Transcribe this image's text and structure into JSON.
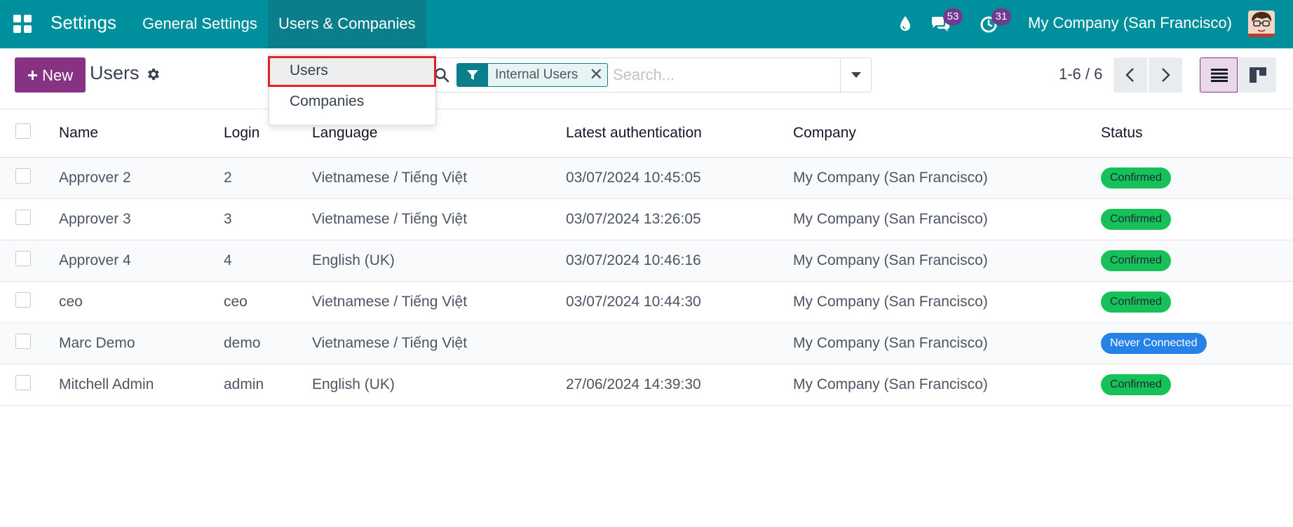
{
  "navbar": {
    "app_name": "Settings",
    "menus": [
      "General Settings",
      "Users & Companies"
    ],
    "messages_count": "53",
    "activities_count": "31",
    "company": "My Company (San Francisco)"
  },
  "dropdown": {
    "items": [
      "Users",
      "Companies"
    ],
    "highlighted": "Users",
    "highlight_color": "#e02424"
  },
  "control_panel": {
    "new_label": "New",
    "title": "Users",
    "facet": "Internal Users",
    "search_placeholder": "Search...",
    "pager": "1-6 / 6"
  },
  "table": {
    "headers": [
      "Name",
      "Login",
      "Language",
      "Latest authentication",
      "Company",
      "Status"
    ],
    "rows": [
      {
        "name": "Approver 2",
        "login": "2",
        "language": "Vietnamese / Tiếng Việt",
        "latest_auth": "03/07/2024 10:45:05",
        "company": "My Company (San Francisco)",
        "status": "Confirmed"
      },
      {
        "name": "Approver 3",
        "login": "3",
        "language": "Vietnamese / Tiếng Việt",
        "latest_auth": "03/07/2024 13:26:05",
        "company": "My Company (San Francisco)",
        "status": "Confirmed"
      },
      {
        "name": "Approver 4",
        "login": "4",
        "language": "English (UK)",
        "latest_auth": "03/07/2024 10:46:16",
        "company": "My Company (San Francisco)",
        "status": "Confirmed"
      },
      {
        "name": "ceo",
        "login": "ceo",
        "language": "Vietnamese / Tiếng Việt",
        "latest_auth": "03/07/2024 10:44:30",
        "company": "My Company (San Francisco)",
        "status": "Confirmed"
      },
      {
        "name": "Marc Demo",
        "login": "demo",
        "language": "Vietnamese / Tiếng Việt",
        "latest_auth": "",
        "company": "My Company (San Francisco)",
        "status": "Never Connected"
      },
      {
        "name": "Mitchell Admin",
        "login": "admin",
        "language": "English (UK)",
        "latest_auth": "27/06/2024 14:39:30",
        "company": "My Company (San Francisco)",
        "status": "Confirmed"
      }
    ]
  },
  "colors": {
    "navbar": "#008f9c",
    "primary": "#873282",
    "confirmed": "#16c159",
    "never_connected": "#2782e8"
  }
}
